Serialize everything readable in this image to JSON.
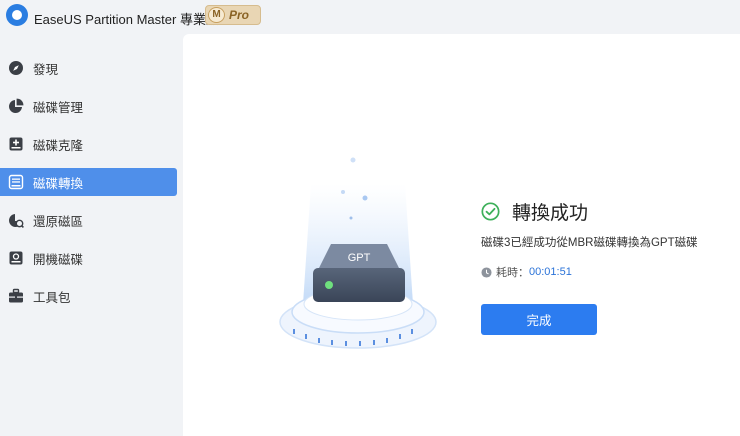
{
  "app": {
    "title": "EaseUS Partition Master 專業版",
    "badge_letter": "M",
    "badge_label": "Pro"
  },
  "sidebar": {
    "items": [
      {
        "label": "發現",
        "icon": "compass-icon"
      },
      {
        "label": "磁碟管理",
        "icon": "pie-chart-icon"
      },
      {
        "label": "磁碟克隆",
        "icon": "disk-clone-icon"
      },
      {
        "label": "磁碟轉換",
        "icon": "disk-convert-icon",
        "active": true
      },
      {
        "label": "還原磁區",
        "icon": "partition-recovery-icon"
      },
      {
        "label": "開機磁碟",
        "icon": "boot-disk-icon"
      },
      {
        "label": "工具包",
        "icon": "toolbox-icon"
      }
    ]
  },
  "illustration": {
    "disk_label": "GPT"
  },
  "result": {
    "title": "轉換成功",
    "message": "磁碟3已經成功從MBR磁碟轉換為GPT磁碟",
    "time_label": "耗時：",
    "time_value": "00:01:51",
    "finish_label": "完成"
  },
  "colors": {
    "accent": "#2c7cf0",
    "active_nav": "#4f8fea",
    "success": "#3db05a",
    "time_value": "#2b73d8"
  }
}
